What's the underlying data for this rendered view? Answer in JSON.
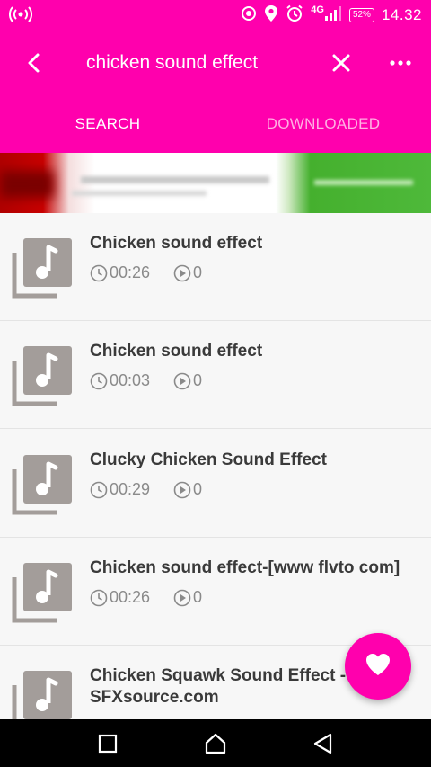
{
  "status_bar": {
    "hotspot_icon": "hotspot-icon",
    "network_type": "4G",
    "battery_level": "52%",
    "time": "14.32",
    "icon_names": [
      "wifi-calling-icon",
      "location-icon",
      "alarm-icon",
      "signal-icon",
      "battery-icon"
    ]
  },
  "toolbar": {
    "search_query": "chicken sound effect",
    "back_icon": "back-arrow-icon",
    "clear_icon": "close-icon",
    "more_icon": "more-options-icon"
  },
  "tabs": [
    {
      "label": "SEARCH",
      "active": true
    },
    {
      "label": "DOWNLOADED",
      "active": false
    }
  ],
  "results": [
    {
      "title": "Chicken sound effect",
      "duration": "00:26",
      "plays": "0"
    },
    {
      "title": "Chicken sound effect",
      "duration": "00:03",
      "plays": "0"
    },
    {
      "title": "Clucky Chicken Sound Effect",
      "duration": "00:29",
      "plays": "0"
    },
    {
      "title": "Chicken sound effect-[www flvto com]",
      "duration": "00:26",
      "plays": "0"
    },
    {
      "title": "Chicken Squawk Sound Effect - SFXsource.com",
      "duration": "",
      "plays": ""
    }
  ],
  "fab": {
    "icon": "heart-icon"
  },
  "nav_bar": {
    "icons": [
      "recent-apps-icon",
      "home-icon",
      "back-icon"
    ]
  },
  "colors": {
    "accent": "#ff00ad",
    "tab_inactive": "#ffb0e3",
    "title_text": "#3a3a3a",
    "meta_text": "#8a8a8a",
    "thumb_gray": "#a39d9a"
  }
}
